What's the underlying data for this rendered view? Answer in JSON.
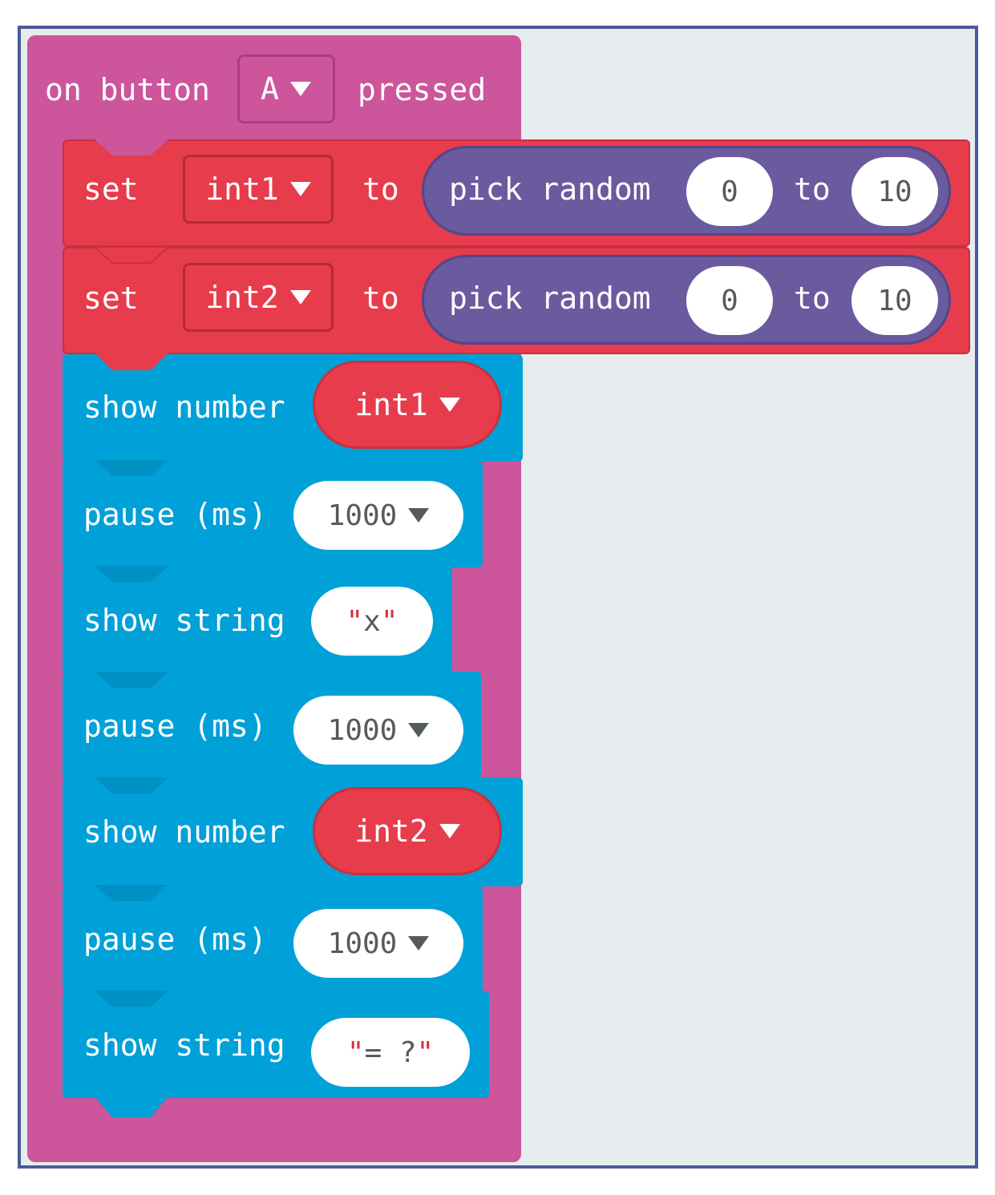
{
  "colors": {
    "event": "#cc559b",
    "variables": "#e63c4c",
    "math": "#6a5a9e",
    "basic": "#00a0d8",
    "background": "#e7ecee",
    "frame": "#4b5a9c"
  },
  "event_block": {
    "label_on": "on button",
    "button": "A",
    "label_pressed": "pressed"
  },
  "blocks": [
    {
      "set": "set",
      "var": "int1",
      "to": "to",
      "func": "pick random",
      "from": "0",
      "to2": "to",
      "max": "10"
    },
    {
      "set": "set",
      "var": "int2",
      "to": "to",
      "func": "pick random",
      "from": "0",
      "to2": "to",
      "max": "10"
    }
  ],
  "basic": [
    {
      "label": "show number",
      "var": "int1"
    },
    {
      "label": "pause (ms)",
      "value": "1000"
    },
    {
      "label": "show string",
      "value": "x"
    },
    {
      "label": "pause (ms)",
      "value": "1000"
    },
    {
      "label": "show number",
      "var": "int2"
    },
    {
      "label": "pause (ms)",
      "value": "1000"
    },
    {
      "label": "show string",
      "value": "= ?"
    }
  ],
  "icons": [
    "dropdown-icon",
    "quote-icon"
  ]
}
